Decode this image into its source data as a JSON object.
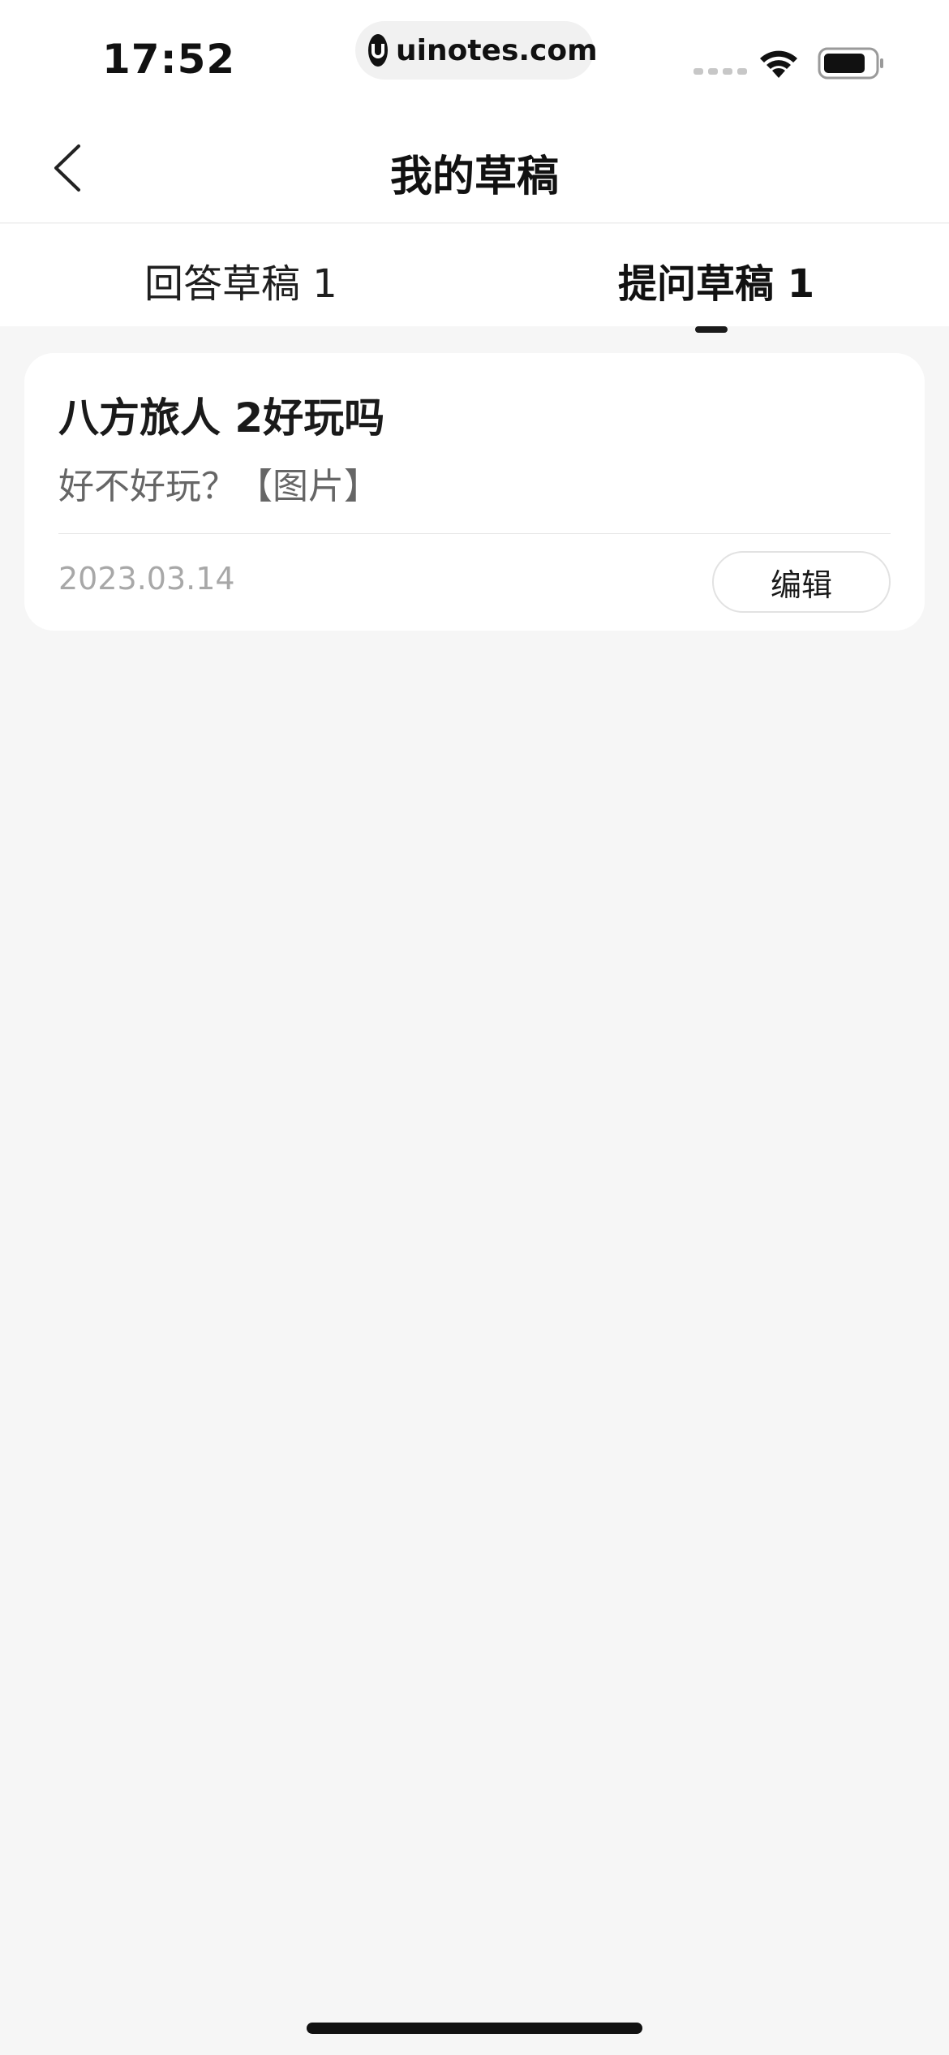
{
  "status_bar": {
    "time": "17:52",
    "url": "uinotes.com",
    "icons": [
      "signal-icon",
      "wifi-icon",
      "battery-icon"
    ]
  },
  "nav": {
    "back_icon": "chevron-left-icon",
    "title": "我的草稿"
  },
  "tabs": [
    {
      "label": "回答草稿 1",
      "active": false
    },
    {
      "label": "提问草稿 1",
      "active": true
    }
  ],
  "drafts": [
    {
      "title": "八方旅人 2好玩吗",
      "body": "好不好玩？【图片】",
      "date": "2023.03.14",
      "edit_label": "编辑"
    }
  ],
  "colors": {
    "background": "#f6f6f6",
    "card": "#ffffff",
    "text_primary": "#1a1a1a",
    "text_secondary": "#666666",
    "text_muted": "#a8a8a8"
  }
}
